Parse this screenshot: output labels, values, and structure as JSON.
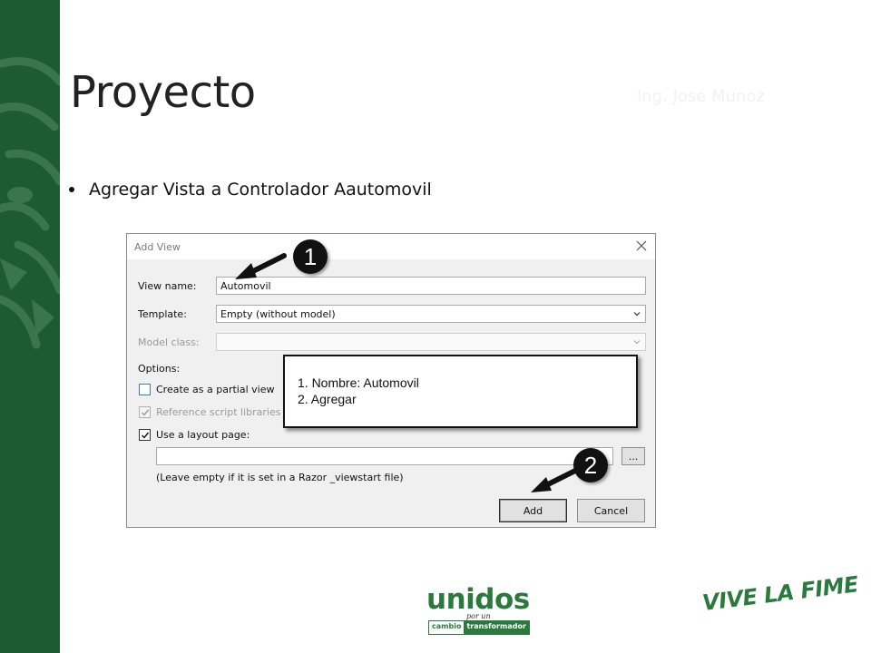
{
  "slide": {
    "title": "Proyecto",
    "author": "Ing. José Munoz",
    "bullet": "Agregar Vista a Controlador Aautomovil"
  },
  "dialog": {
    "title": "Add View",
    "view_name_label": "View name:",
    "view_name_value": "Automovil",
    "template_label": "Template:",
    "template_value": "Empty (without model)",
    "model_class_label": "Model class:",
    "model_class_value": "",
    "options_label": "Options:",
    "partial_view_label": "Create as a partial view",
    "partial_view_checked": false,
    "script_libs_label": "Reference script libraries",
    "script_libs_checked": true,
    "layout_page_label": "Use a layout page:",
    "layout_page_checked": true,
    "layout_path_value": "",
    "browse_label": "...",
    "hint": "(Leave empty if it is set in a Razor _viewstart file)",
    "add_label": "Add",
    "cancel_label": "Cancel"
  },
  "callouts": {
    "badge_1": "1",
    "badge_2": "2",
    "note_line_1": "1. Nombre: Automovil",
    "note_line_2": "2. Agregar"
  },
  "footer": {
    "logo_main": "unidos",
    "logo_por_un": "por un",
    "logo_cambio": "cambio",
    "logo_transformador": "transformador",
    "slogan": "VIVE LA FIME"
  },
  "colors": {
    "brand_green": "#1e5a33",
    "logo_green": "#2b7a3d"
  },
  "icons": [
    "close-icon",
    "chevron-down-icon",
    "checkmark-icon",
    "arrow-icon",
    "tiger-watermark"
  ]
}
